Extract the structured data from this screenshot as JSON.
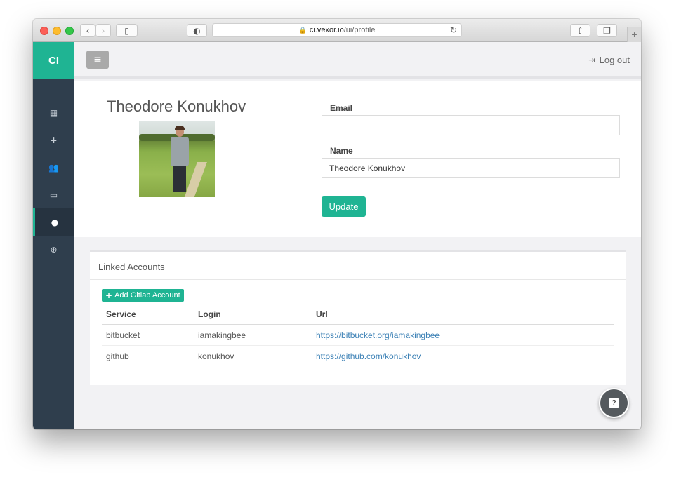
{
  "browser": {
    "url_host": "ci.vexor.io",
    "url_path": "/ui/profile",
    "icons": {
      "back": "chevron-left-icon",
      "forward": "chevron-right-icon",
      "sidebar": "sidebar-icon",
      "reader": "reader-icon",
      "reload": "reload-icon",
      "share": "share-icon",
      "tabs": "tabs-icon",
      "new_tab": "plus-icon"
    }
  },
  "sidebar": {
    "brand": "CI",
    "items": [
      {
        "icon": "dashboard-icon"
      },
      {
        "icon": "plus-icon"
      },
      {
        "icon": "team-icon"
      },
      {
        "icon": "credit-card-icon"
      },
      {
        "icon": "user-icon",
        "active": true
      },
      {
        "icon": "lifebuoy-icon"
      }
    ]
  },
  "header": {
    "logout_label": "Log out"
  },
  "profile": {
    "name": "Theodore Konukhov",
    "email_label": "Email",
    "email_value": "",
    "name_label": "Name",
    "name_value": "Theodore Konukhov",
    "update_label": "Update"
  },
  "linked_accounts": {
    "title": "Linked Accounts",
    "add_button": "Add Gitlab Account",
    "columns": [
      "Service",
      "Login",
      "Url"
    ],
    "rows": [
      {
        "service": "bitbucket",
        "login": "iamakingbee",
        "url": "https://bitbucket.org/iamakingbee"
      },
      {
        "service": "github",
        "login": "konukhov",
        "url": "https://github.com/konukhov"
      }
    ]
  },
  "colors": {
    "accent": "#1fb493",
    "sidebar": "#2f3e4d",
    "link": "#3b80b5"
  }
}
